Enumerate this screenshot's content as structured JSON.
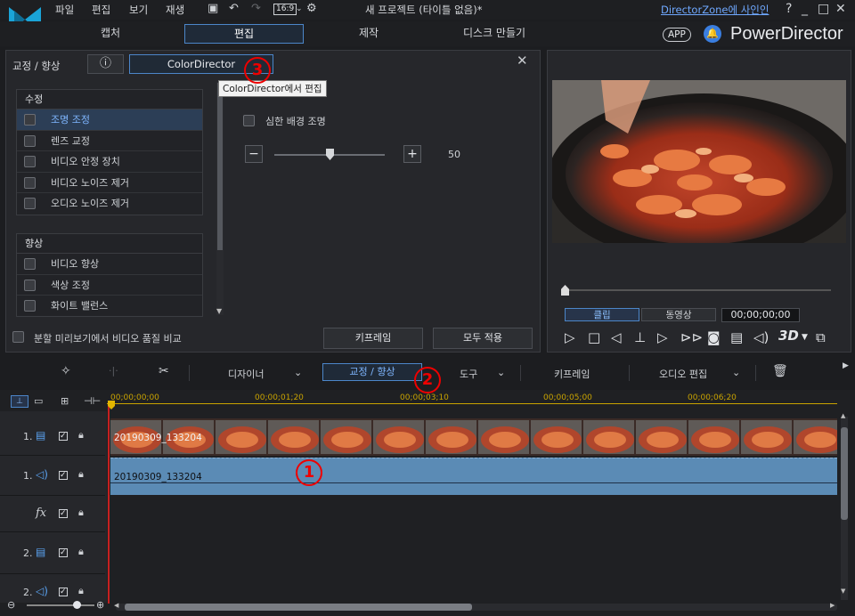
{
  "menu": [
    "파일",
    "편집",
    "보기",
    "재생"
  ],
  "toolbar_top": {
    "aspect": "16:9"
  },
  "window": {
    "title": "새 프로젝트 (타이틀 없음)*",
    "signin": "DirectorZone에 사인인",
    "help": "?",
    "minimize": "_",
    "maximize": "□",
    "close": "✕"
  },
  "mode_tabs": [
    "캡처",
    "편집",
    "제작",
    "디스크 만들기"
  ],
  "brand": {
    "app_badge": "APP",
    "name": "PowerDirector"
  },
  "fix_panel": {
    "title": "교정 / 향상",
    "info": "ⓘ",
    "colordirector": "ColorDirector",
    "tooltip": "ColorDirector에서 편집",
    "group1": {
      "title": "수정",
      "items": [
        "조명 조정",
        "렌즈 교정",
        "비디오 안정 장치",
        "비디오 노이즈 제거",
        "오디오 노이즈 제거"
      ]
    },
    "group2": {
      "title": "향상",
      "items": [
        "비디오 향상",
        "색상 조정",
        "화이트 밸런스"
      ]
    },
    "harsh_label": "심한 배경 조명",
    "slider": {
      "minus": "−",
      "plus": "+",
      "value": "50",
      "fraction": 0.5
    },
    "split_label": "분할 미리보기에서 비디오 품질 비교",
    "keyframe_btn": "키프레임",
    "apply_all_btn": "모두 적용"
  },
  "preview": {
    "tab_clip": "클립",
    "tab_movie": "동영상",
    "timecode": "00;00;00;00"
  },
  "edit_toolbar": {
    "designer": "디자이너",
    "fix": "교정 / 향상",
    "tools": "도구",
    "keyframe": "키프레임",
    "audio_edit": "오디오 편집"
  },
  "ruler": [
    "00;00;00;00",
    "00;00;01;20",
    "00;00;03;10",
    "00;00;05;00",
    "00;00;06;20"
  ],
  "tracks": {
    "v1": "1.",
    "a1": "1.",
    "fx": "fx",
    "v2": "2.",
    "a2": "2."
  },
  "clips": {
    "video": "20190309_133204",
    "audio": "20190309_133204"
  },
  "markers": {
    "m1": "1",
    "m2": "2",
    "m3": "3"
  },
  "icons": [
    "monitor-icon",
    "speaker-icon",
    "lock-icon",
    "scissors-icon",
    "trash-icon",
    "magic-icon",
    "split-icon"
  ]
}
